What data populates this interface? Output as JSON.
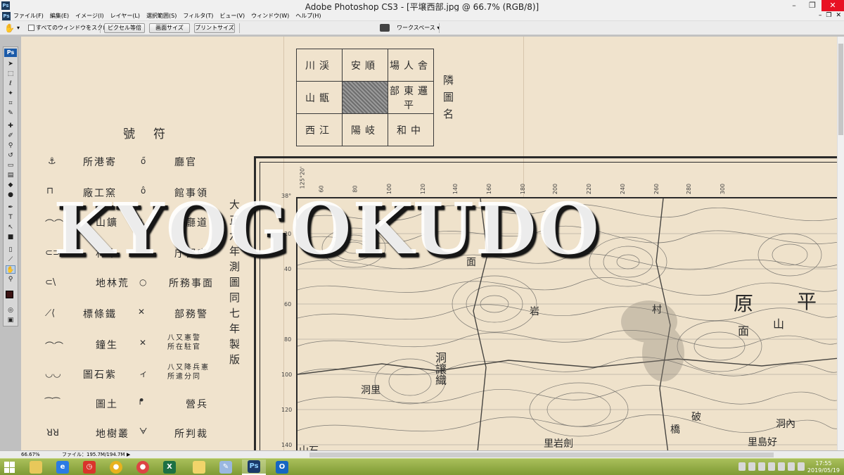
{
  "window": {
    "title": "Adobe Photoshop CS3 - [平壌西部.jpg @ 66.7% (RGB/8)]",
    "app_icon": "Ps",
    "controls": [
      "–",
      "❐",
      "✕"
    ]
  },
  "menu": {
    "items": [
      "ファイル(F)",
      "編集(E)",
      "イメージ(I)",
      "レイヤー(L)",
      "選択範囲(S)",
      "フィルタ(T)",
      "ビュー(V)",
      "ウィンドウ(W)",
      "ヘルプ(H)"
    ],
    "right_controls": [
      "–",
      "❐",
      "✕"
    ]
  },
  "options": {
    "scroll_all_label": "すべてのウィンドウをスクロール",
    "buttons": [
      "ピクセル等倍",
      "画面サイズ",
      "プリントサイズ"
    ],
    "workspace_label": "ワークスペース ▾"
  },
  "toolbox": {
    "ps_label": "Ps",
    "tools": [
      "move-icon",
      "marquee-icon",
      "lasso-icon",
      "magic-wand-icon",
      "crop-icon",
      "slice-icon",
      "healing-brush-icon",
      "brush-icon",
      "clone-stamp-icon",
      "history-brush-icon",
      "eraser-icon",
      "gradient-icon",
      "blur-icon",
      "dodge-icon",
      "pen-icon",
      "type-icon",
      "path-select-icon",
      "shape-icon",
      "notes-icon",
      "eyedropper-icon",
      "hand-icon",
      "zoom-icon"
    ],
    "foreground_color": "#3b1313",
    "background_color": "#ffffff"
  },
  "document": {
    "neighbor_grid": [
      [
        "川渓",
        "安順",
        "場人舎"
      ],
      [
        "山甑",
        "",
        "部東邏平"
      ],
      [
        "西江",
        "陽岐",
        "和中"
      ]
    ],
    "neighbor_label": "隣圖名",
    "legend_title": "號符",
    "legend_left": [
      "所港寄",
      "廠工窯",
      "山鑛",
      "林木",
      "地林荒",
      "標條鐵",
      "鐘生",
      "圖石紫",
      "圖土",
      "地樹叢"
    ],
    "legend_right": [
      "廳官",
      "館事領",
      "廳道",
      "庁郡府",
      "所務事面",
      "部務警",
      "八又憲警 所在駐官",
      "八又降兵憲 所遣分同",
      "營兵",
      "所判裁"
    ],
    "legend_right_symbols": [
      "ő",
      "ô",
      "⬭",
      "◯",
      "○",
      "✕",
      "✕",
      "ィ",
      "ᖰ",
      "ᗄ"
    ],
    "legend_left_symbols": [
      "⚓",
      "⊓",
      "⌒⌒",
      "⊂⊃",
      "⊂\\",
      "⟋⟨",
      "⌒⌒",
      "◡◡",
      "⁀⁀",
      "ꓤꓤ"
    ],
    "issue_note": "大正六年測圖同七年製版",
    "watermark": "KYOGOKUDO",
    "map_places": [
      {
        "name": "平",
        "size": 28
      },
      {
        "name": "原",
        "size": 28
      },
      {
        "name": "山",
        "size": 16
      },
      {
        "name": "面",
        "size": 16
      },
      {
        "name": "洞讓織",
        "size": 16
      },
      {
        "name": "里岩劍",
        "size": 14
      },
      {
        "name": "洞里",
        "size": 14
      },
      {
        "name": "面",
        "size": 14
      },
      {
        "name": "村",
        "size": 14
      },
      {
        "name": "里島好",
        "size": 14
      },
      {
        "name": "洞內",
        "size": 14
      },
      {
        "name": "山石",
        "size": 14
      },
      {
        "name": "岩",
        "size": 14
      },
      {
        "name": "橋",
        "size": 14
      },
      {
        "name": "破",
        "size": 14
      }
    ],
    "map_ticks_top": [
      "38°",
      "125°20'",
      "60",
      "80",
      "100",
      "120",
      "140",
      "160",
      "180",
      "200",
      "220",
      "240",
      "260",
      "280",
      "300"
    ],
    "map_ticks_left": [
      "20",
      "40",
      "60",
      "80",
      "100",
      "120",
      "140"
    ]
  },
  "status": {
    "zoom": "66.67%",
    "file_info": "ファイル：195.7M/194.7M",
    "arrow": "▶"
  },
  "taskbar": {
    "apps": [
      "file-explorer-icon",
      "ie-icon",
      "alarm-app-icon",
      "chrome-icon",
      "chrome-alt-icon",
      "excel-icon",
      "photo-icon",
      "paint-icon",
      "photoshop-icon",
      "outlook-icon"
    ],
    "active_app": "photoshop-icon",
    "time": "17:55",
    "date": "2019/05/19"
  }
}
